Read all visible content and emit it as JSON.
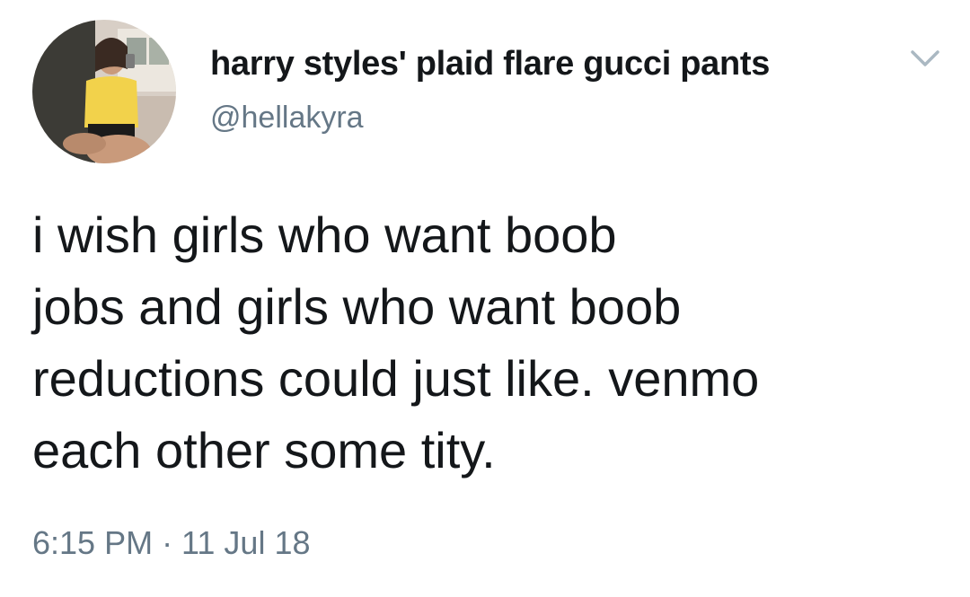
{
  "tweet": {
    "display_name": "harry styles' plaid flare gucci pants",
    "handle": "@hellakyra",
    "text": "i wish girls who want boob\njobs and girls who want boob\nreductions could just like. venmo\neach other some tity.",
    "timestamp": "6:15 PM · 11 Jul 18",
    "avatar": "profile-photo",
    "menu_icon": "chevron-down-icon"
  },
  "colors": {
    "text_primary": "#14171a",
    "text_secondary": "#657786",
    "background": "#ffffff"
  }
}
